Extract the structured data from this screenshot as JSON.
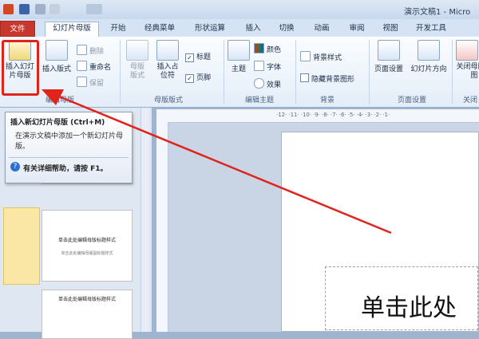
{
  "window": {
    "title": "演示文稿1 - Micro"
  },
  "tabs": [
    "文件",
    "幻灯片母版",
    "开始",
    "经典菜单",
    "形状运算",
    "插入",
    "切换",
    "动画",
    "审阅",
    "视图",
    "开发工具"
  ],
  "ribbon": {
    "groups": {
      "edit_master": "编辑母版",
      "master_layout": "母版版式",
      "edit_theme": "编辑主题",
      "background": "背景",
      "page_setup": "页面设置",
      "close": "关闭"
    },
    "buttons": {
      "insert_slide_master": "插入幻灯片母版",
      "insert_layout": "插入版式",
      "delete": "删除",
      "rename": "重命名",
      "preserve": "保留",
      "master_layout": "母版版式",
      "insert_placeholder": "插入占位符",
      "title": "标题",
      "footer": "页脚",
      "themes": "主题",
      "colors": "颜色",
      "fonts": "字体",
      "effects": "效果",
      "background_styles": "背景样式",
      "hide_bg_graphics": "隐藏背景图形",
      "page_setup": "页面设置",
      "slide_orientation": "幻灯片方向",
      "close_master": "关闭母版视图"
    },
    "checkbox_title_checked": true,
    "checkbox_footer_checked": true,
    "checkbox_hide_bg_checked": false
  },
  "tooltip": {
    "title": "插入新幻灯片母版 (Ctrl+M)",
    "body": "在演示文稿中添加一个新幻灯片母版。",
    "help": "有关详细帮助，请按 F1。"
  },
  "thumbnails": {
    "thumb2_title": "单击此处编辑母版标题样式",
    "thumb2_sub": "单击此处编辑母版副标题样式",
    "thumb3_title": "单击此处编辑母版标题样式"
  },
  "slide": {
    "title_text": "单击此处"
  },
  "ruler_marks": [
    "12",
    "11",
    "10",
    "9",
    "8",
    "7",
    "6",
    "5",
    "4",
    "3",
    "2",
    "1"
  ],
  "colors": {
    "annotation": "#e0241c",
    "file_tab": "#c8372e"
  }
}
